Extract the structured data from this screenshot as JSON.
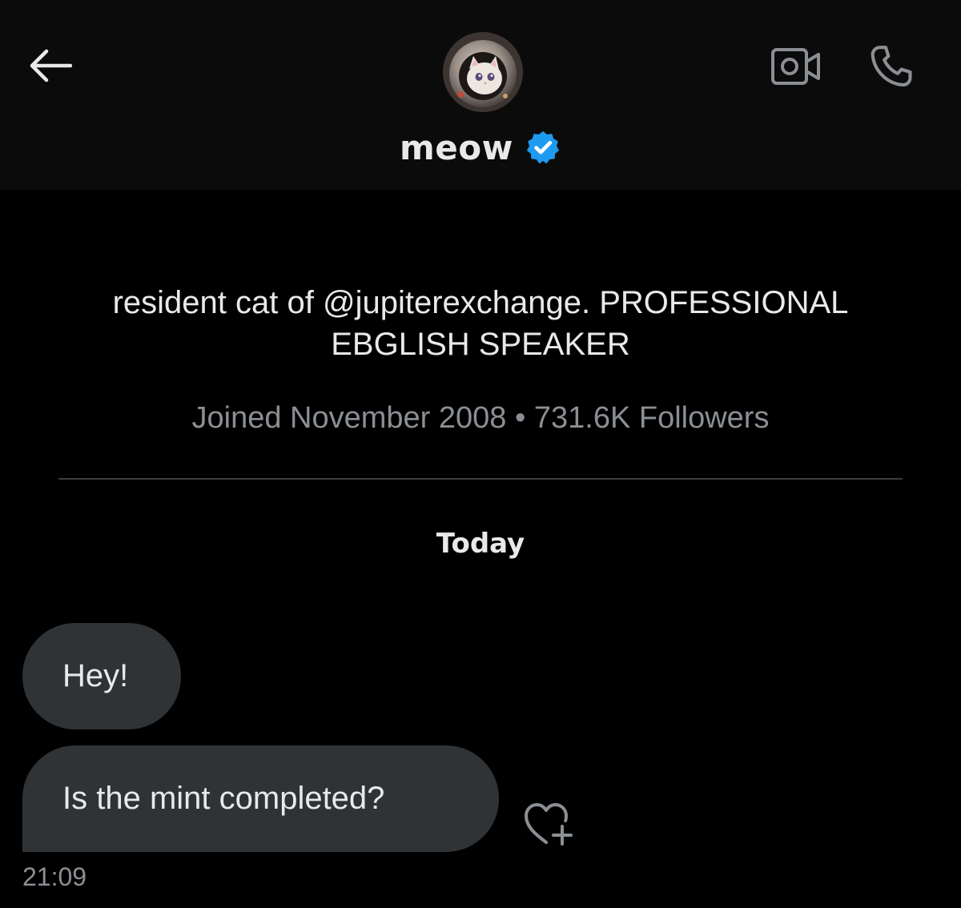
{
  "header": {
    "display_name": "meow",
    "back_icon": "arrow-left-icon",
    "verified_icon": "verified-badge-icon",
    "video_icon": "video-camera-icon",
    "call_icon": "phone-icon"
  },
  "profile": {
    "bio_line1": "resident cat of @jupiterexchange. PROFESSIONAL",
    "bio_line2": "EBGLISH SPEAKER",
    "joined": "Joined November 2008",
    "separator": "•",
    "followers": "731.6K Followers"
  },
  "conversation": {
    "day_label": "Today",
    "messages": [
      {
        "text": "Hey!"
      },
      {
        "text": "Is the mint completed?"
      }
    ],
    "last_timestamp": "21:09",
    "react_icon": "heart-plus-icon"
  },
  "colors": {
    "background": "#000000",
    "header_background": "#0b0b0b",
    "bubble": "#2f3336",
    "text_primary": "#e7e9ea",
    "text_secondary": "#8b8f94",
    "verified_blue": "#1d9bf0"
  }
}
